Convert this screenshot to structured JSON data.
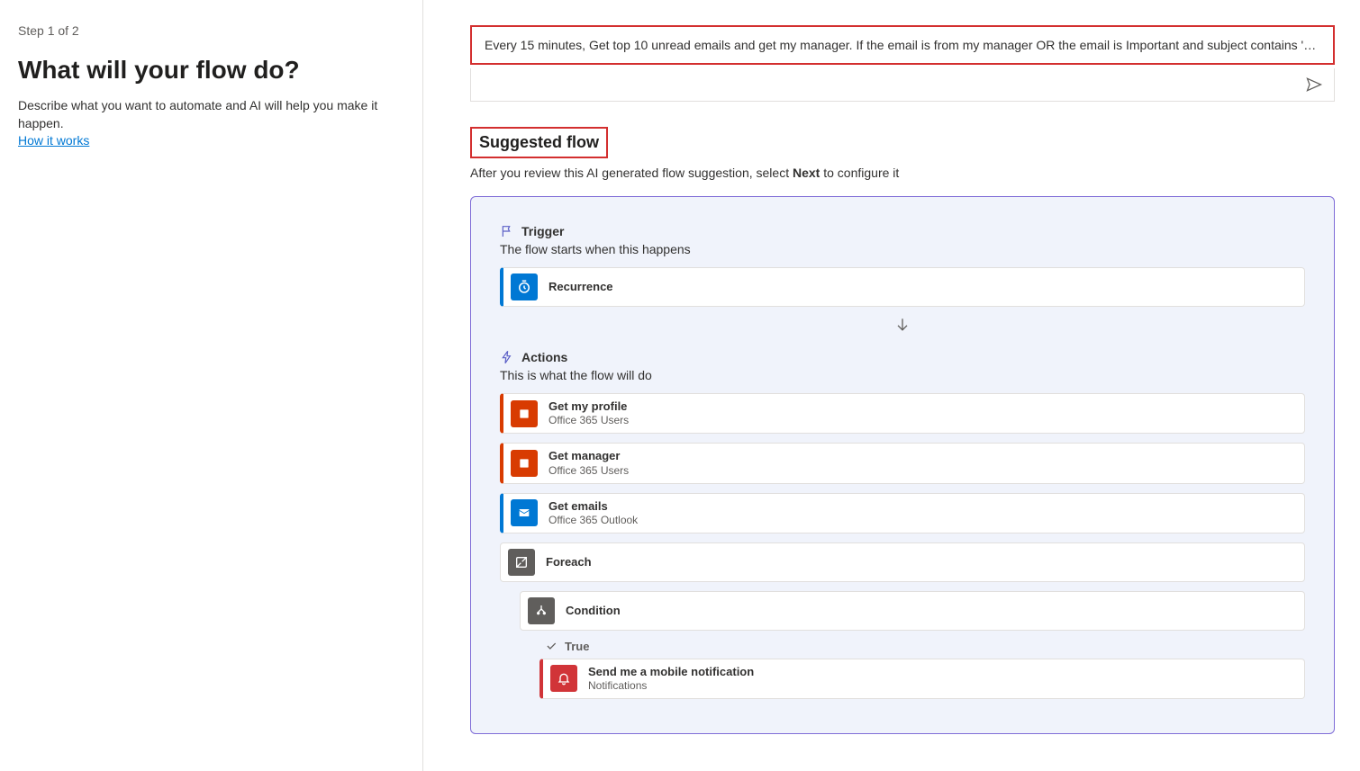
{
  "left": {
    "step": "Step 1 of 2",
    "heading": "What will your flow do?",
    "description": "Describe what you want to automate and AI will help you make it happen.",
    "howItWorks": "How it works"
  },
  "prompt": {
    "text": "Every 15 minutes, Get top 10 unread emails and get my manager. If the email is from my manager OR the email is Important and subject contains 'mee..."
  },
  "suggested": {
    "title": "Suggested flow",
    "subPrefix": "After you review this AI generated flow suggestion, select ",
    "subBold": "Next",
    "subSuffix": " to configure it"
  },
  "flow": {
    "triggerSection": {
      "label": "Trigger",
      "sub": "The flow starts when this happens"
    },
    "trigger": {
      "title": "Recurrence"
    },
    "actionsSection": {
      "label": "Actions",
      "sub": "This is what the flow will do"
    },
    "actions": [
      {
        "title": "Get my profile",
        "service": "Office 365 Users"
      },
      {
        "title": "Get manager",
        "service": "Office 365 Users"
      },
      {
        "title": "Get emails",
        "service": "Office 365 Outlook"
      }
    ],
    "foreach": {
      "title": "Foreach"
    },
    "condition": {
      "title": "Condition"
    },
    "trueLabel": "True",
    "notify": {
      "title": "Send me a mobile notification",
      "service": "Notifications"
    }
  }
}
